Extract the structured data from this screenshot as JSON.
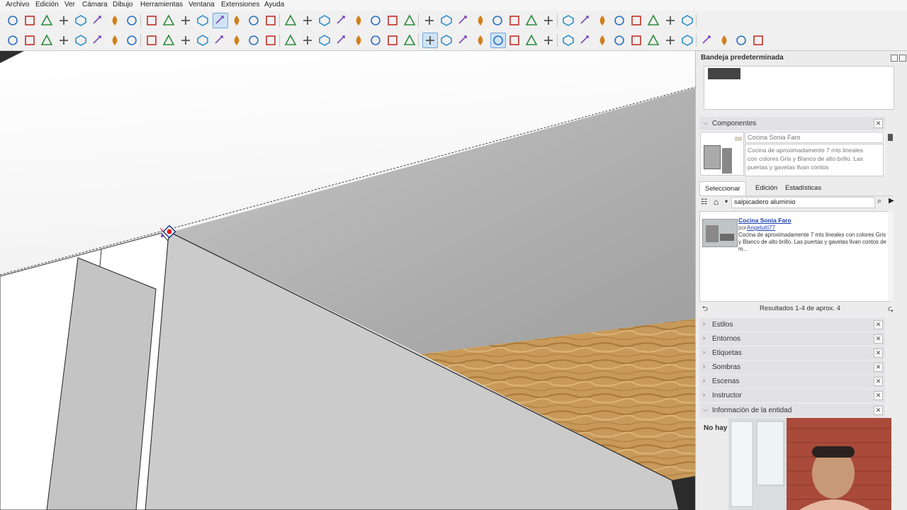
{
  "menu": [
    "Archivo",
    "Edición",
    "Ver",
    "Cámara",
    "Dibujo",
    "Herramientas",
    "Ventana",
    "Extensiones",
    "Ayuda"
  ],
  "toolbar_icons": {
    "row1": [
      "zoom-icon",
      "select-icon",
      "eraser-icon",
      "pencil-icon",
      "arc-icon",
      "shape-icon",
      "push-pull-icon",
      "follow-me-icon",
      "move-icon",
      "rotate-icon",
      "scale-icon",
      "offset-icon",
      "orbit-icon",
      "pan-icon",
      "walk-icon",
      "position-camera-icon",
      "look-around-icon",
      "zoom-window-icon",
      "zoom-extents-icon",
      "sandbox-icon",
      "smoove-icon",
      "stamp-icon",
      "drape-icon",
      "warehouse-icon",
      "tape-icon",
      "protractor-icon",
      "axes-icon",
      "dimension-icon",
      "text-icon",
      "section-icon",
      "styles-icon",
      "solid-tools-icon",
      "union-icon",
      "subtract-icon",
      "trim-icon",
      "split-icon",
      "model-info-icon",
      "components-icon",
      "new-file-icon",
      "profile-icon"
    ],
    "row2": [
      "paint-bucket-icon",
      "layers-icon",
      "iso-view-icon",
      "top-view-icon",
      "front-view-icon",
      "right-view-icon",
      "back-view-icon",
      "left-view-icon",
      "bottom-view-icon",
      "xray-icon",
      "wireframe-icon",
      "hidden-line-icon",
      "shaded-icon",
      "textured-icon",
      "monochrome-icon",
      "section-plane-icon",
      "section-fill-icon",
      "section-cut-icon",
      "square-icon",
      "settings-icon",
      "close-icon",
      "water-icon",
      "fill-icon",
      "drop-icon",
      "active-drop-icon",
      "layer-drop-icon",
      "magnet-icon",
      "snap-icon",
      "magnet-active-icon",
      "add-icon",
      "line-tool-icon",
      "hex-icon",
      "hex2-icon",
      "hex3-icon",
      "hex4-icon",
      "explode-icon",
      "rotate-sel-icon",
      "grid1-icon",
      "grid2-icon",
      "grid3-icon",
      "dcl-icon",
      "handshake-icon",
      "axis-up-icon",
      "export-icon"
    ]
  },
  "tray": {
    "title": "Bandeja predeterminada",
    "panels": {
      "components": "Componentes",
      "estilos": "Estilos",
      "entornos": "Entornos",
      "etiquetas": "Etiquetas",
      "sombras": "Sombras",
      "escenas": "Escenas",
      "instructor": "Instructor",
      "info": "Información de la entidad"
    },
    "component": {
      "name": "Cocina Sonia Faro",
      "description": "Cocina de aproximadamente 7 mts lineales con colores Gris y Blanco de alto brillo. Las puertas y gavetas llvan contos"
    },
    "tabs": [
      "Seleccionar",
      "Edición",
      "Estadísticas"
    ],
    "search_value": "salpicadero aluminio",
    "result": {
      "title": "Cocina Sonia Faro",
      "by_prefix": "por",
      "author": "Angelutti77",
      "desc": "Cocina de aproximadamente 7 mts lineales con colores Gris y Blanco de alto brillo. Las puertas y gavetas llvan contos de m..."
    },
    "results_text": "Resultados 1-4 de aprox. 4",
    "info_text": "No hay"
  }
}
